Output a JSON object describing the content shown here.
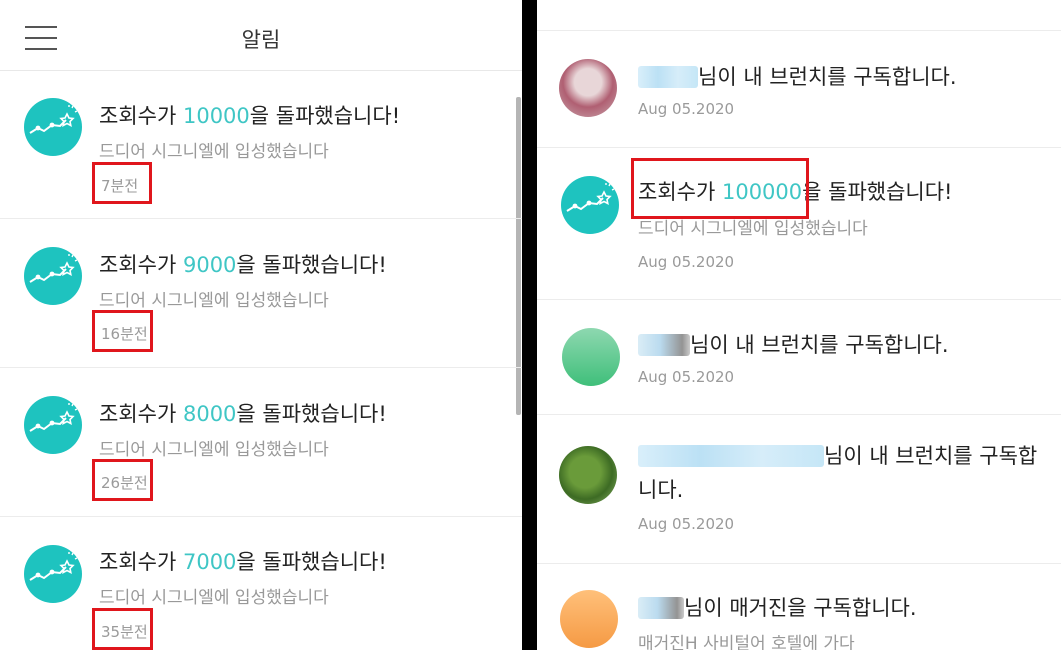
{
  "left": {
    "header": {
      "title": "알림"
    },
    "items": [
      {
        "prefix": "조회수가 ",
        "count": "10000",
        "suffix": "을 돌파했습니다!",
        "desc": "드디어 시그니엘에 입성했습니다",
        "time": "7분전"
      },
      {
        "prefix": "조회수가 ",
        "count": "9000",
        "suffix": "을 돌파했습니다!",
        "desc": "드디어 시그니엘에 입성했습니다",
        "time": "16분전"
      },
      {
        "prefix": "조회수가 ",
        "count": "8000",
        "suffix": "을 돌파했습니다!",
        "desc": "드디어 시그니엘에 입성했습니다",
        "time": "26분전"
      },
      {
        "prefix": "조회수가 ",
        "count": "7000",
        "suffix": "을 돌파했습니다!",
        "desc": "드디어 시그니엘에 입성했습니다",
        "time": "35분전"
      }
    ]
  },
  "right": {
    "items": [
      {
        "text": "님이 내 브런치를 구독합니다.",
        "time": "Aug 05.2020"
      },
      {
        "prefix": "조회수가 ",
        "count": "100000",
        "suffix": "을 돌파했습니다!",
        "desc": "드디어 시그니엘에 입성했습니다",
        "time": "Aug 05.2020"
      },
      {
        "text": "님이 내 브런치를 구독합니다.",
        "time": "Aug 05.2020"
      },
      {
        "text_line1": "님이 내 브런치를 구독합",
        "text_line2": "니다.",
        "time": "Aug 05.2020"
      },
      {
        "text": "님이 매거진을 구독합니다.",
        "desc": "매거진H 사비털어 호텔에 가다"
      }
    ]
  },
  "colors": {
    "accent": "#3fc6c5",
    "icon_teal": "#1ec3bf",
    "highlight_box": "#e0161c"
  }
}
